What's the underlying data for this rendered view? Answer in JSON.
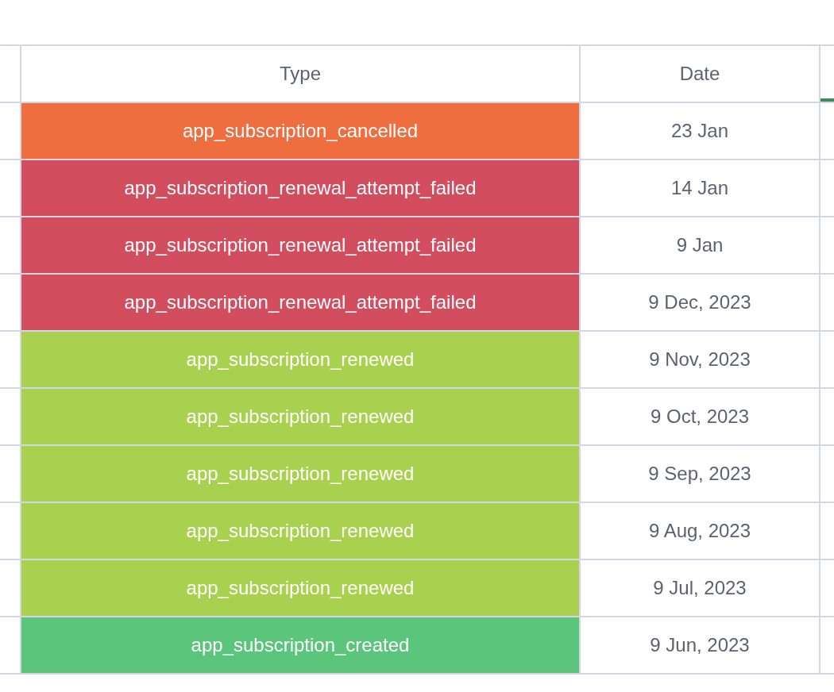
{
  "table": {
    "columns": [
      {
        "label": "Type"
      },
      {
        "label": "Date"
      }
    ],
    "rows": [
      {
        "type": "app_subscription_cancelled",
        "date": "23 Jan",
        "color": "#ee6e40"
      },
      {
        "type": "app_subscription_renewal_attempt_failed",
        "date": "14 Jan",
        "color": "#d24e5f"
      },
      {
        "type": "app_subscription_renewal_attempt_failed",
        "date": "9 Jan",
        "color": "#d24e5f"
      },
      {
        "type": "app_subscription_renewal_attempt_failed",
        "date": "9 Dec, 2023",
        "color": "#d24e5f"
      },
      {
        "type": "app_subscription_renewed",
        "date": "9 Nov, 2023",
        "color": "#a9d04e"
      },
      {
        "type": "app_subscription_renewed",
        "date": "9 Oct, 2023",
        "color": "#a9d04e"
      },
      {
        "type": "app_subscription_renewed",
        "date": "9 Sep, 2023",
        "color": "#a9d04e"
      },
      {
        "type": "app_subscription_renewed",
        "date": "9 Aug, 2023",
        "color": "#a9d04e"
      },
      {
        "type": "app_subscription_renewed",
        "date": "9 Jul, 2023",
        "color": "#a9d04e"
      },
      {
        "type": "app_subscription_created",
        "date": "9 Jun, 2023",
        "color": "#5bc57b"
      }
    ]
  }
}
